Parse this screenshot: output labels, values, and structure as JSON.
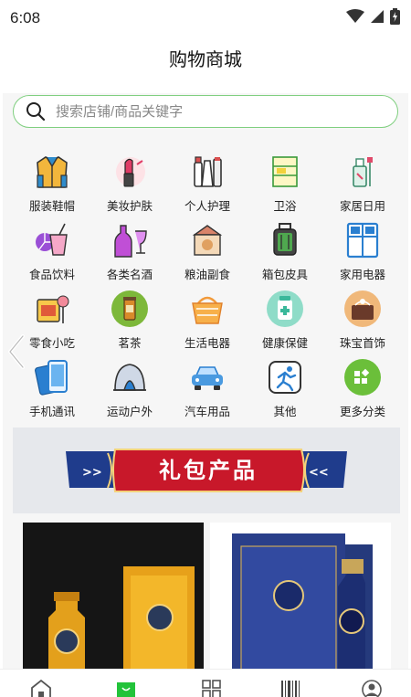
{
  "status": {
    "time": "6:08",
    "icons": [
      "wifi-icon",
      "signal-icon",
      "battery-icon"
    ]
  },
  "header": {
    "title": "购物商城"
  },
  "search": {
    "placeholder": "搜索店铺/商品关键字"
  },
  "categories": [
    {
      "label": "服装鞋帽",
      "icon": "jacket-icon"
    },
    {
      "label": "美妆护肤",
      "icon": "lipstick-icon"
    },
    {
      "label": "个人护理",
      "icon": "personal-care-icon"
    },
    {
      "label": "卫浴",
      "icon": "bathroom-icon"
    },
    {
      "label": "家居日用",
      "icon": "household-icon"
    },
    {
      "label": "食品饮料",
      "icon": "drink-icon"
    },
    {
      "label": "各类名酒",
      "icon": "wine-icon"
    },
    {
      "label": "粮油副食",
      "icon": "grain-icon"
    },
    {
      "label": "箱包皮具",
      "icon": "luggage-icon"
    },
    {
      "label": "家用电器",
      "icon": "fridge-icon"
    },
    {
      "label": "零食小吃",
      "icon": "snack-icon"
    },
    {
      "label": "茗茶",
      "icon": "tea-icon"
    },
    {
      "label": "生活电器",
      "icon": "basket-icon"
    },
    {
      "label": "健康保健",
      "icon": "health-icon"
    },
    {
      "label": "珠宝首饰",
      "icon": "jewelry-icon"
    },
    {
      "label": "手机通讯",
      "icon": "phone-icon"
    },
    {
      "label": "运动户外",
      "icon": "tent-icon"
    },
    {
      "label": "汽车用品",
      "icon": "car-icon"
    },
    {
      "label": "其他",
      "icon": "running-icon"
    },
    {
      "label": "更多分类",
      "icon": "more-icon"
    }
  ],
  "banner": {
    "text": "礼包产品",
    "colors": {
      "ribbon": "#c8182a",
      "band": "#1f3c8c",
      "background": "#e6e8ec"
    }
  },
  "products": [
    {
      "icon": "baijiu-gift-box-yellow-image"
    },
    {
      "icon": "baijiu-gift-box-blue-image"
    }
  ],
  "tabs": [
    {
      "icon": "home-icon"
    },
    {
      "icon": "shop-icon",
      "active": true
    },
    {
      "icon": "category-grid-icon"
    },
    {
      "icon": "scan-icon"
    },
    {
      "icon": "user-icon"
    }
  ],
  "colors": {
    "accent": "#22c33a",
    "search_border": "#7fcf7f"
  }
}
